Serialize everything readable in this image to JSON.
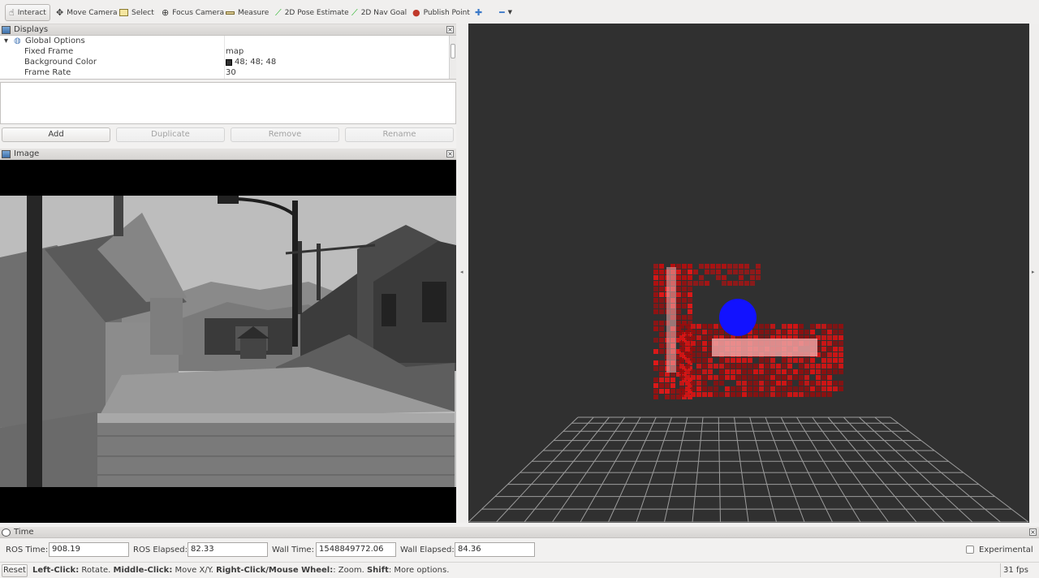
{
  "toolbar": {
    "tools": [
      {
        "label": "Interact",
        "icon": "hand-icon"
      },
      {
        "label": "Move Camera",
        "icon": "move-icon"
      },
      {
        "label": "Select",
        "icon": "select-box-icon"
      },
      {
        "label": "Focus Camera",
        "icon": "crosshair-icon"
      },
      {
        "label": "Measure",
        "icon": "ruler-icon"
      },
      {
        "label": "2D Pose Estimate",
        "icon": "green-arrow-icon"
      },
      {
        "label": "2D Nav Goal",
        "icon": "green-arrow-icon"
      },
      {
        "label": "Publish Point",
        "icon": "map-pin-icon"
      }
    ],
    "active_tool": "Interact"
  },
  "displays": {
    "title": "Displays",
    "rows": [
      {
        "name": "Global Options",
        "value": ""
      },
      {
        "name": "Fixed Frame",
        "value": "map"
      },
      {
        "name": "Background Color",
        "value": "48; 48; 48"
      },
      {
        "name": "Frame Rate",
        "value": "30"
      }
    ],
    "buttons": {
      "add": "Add",
      "duplicate": "Duplicate",
      "remove": "Remove",
      "rename": "Rename"
    }
  },
  "image_panel": {
    "title": "Image"
  },
  "time": {
    "title": "Time",
    "ros_time_label": "ROS Time:",
    "ros_time": "908.19",
    "ros_elapsed_label": "ROS Elapsed:",
    "ros_elapsed": "82.33",
    "wall_time_label": "Wall Time:",
    "wall_time": "1548849772.06",
    "wall_elapsed_label": "Wall Elapsed:",
    "wall_elapsed": "84.36",
    "experimental_label": "Experimental"
  },
  "status": {
    "reset_label": "Reset",
    "left_click_key": "Left-Click:",
    "left_click_text": " Rotate. ",
    "middle_click_key": "Middle-Click:",
    "middle_click_text": " Move X/Y. ",
    "right_click_key": "Right-Click/Mouse Wheel:",
    "right_click_text": ": Zoom. ",
    "shift_key": "Shift",
    "shift_text": ": More options.",
    "fps": "31 fps"
  },
  "colors": {
    "background": "#303030",
    "grid": "#a0a0a0",
    "occupancy": "#d01010",
    "robot": "#1010ff"
  }
}
